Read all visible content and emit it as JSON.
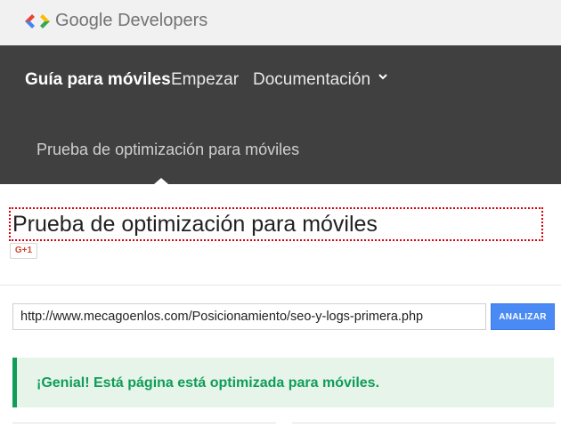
{
  "header": {
    "brand_google": "Google",
    "brand_developers": "Developers",
    "logo_icon": "google-developers-logo-icon",
    "colors": {
      "background": "#f1f1f1",
      "blue": "#4285f4",
      "red": "#ea4335",
      "yellow": "#fbbc05",
      "green": "#34a853"
    }
  },
  "nav": {
    "items": [
      {
        "label": "Guía para móviles",
        "active": true
      },
      {
        "label": "Empezar"
      },
      {
        "label": "Documentación",
        "icon": "chevron-down-icon"
      }
    ],
    "sub_item": "Prueba de optimización para móviles",
    "background": "#404040"
  },
  "page": {
    "title": "Prueba de optimización para móviles",
    "gplus_label": "G+1"
  },
  "form": {
    "url_value": "http://www.mecagoenlos.com/Posicionamiento/seo-y-logs-primera.php",
    "analyze_label": "ANALIZAR",
    "accent": "#4a8af4"
  },
  "result": {
    "message": "¡Genial! Está página está optimizada para móviles.",
    "color": "#0f9d58",
    "background": "#e6f4ea"
  }
}
